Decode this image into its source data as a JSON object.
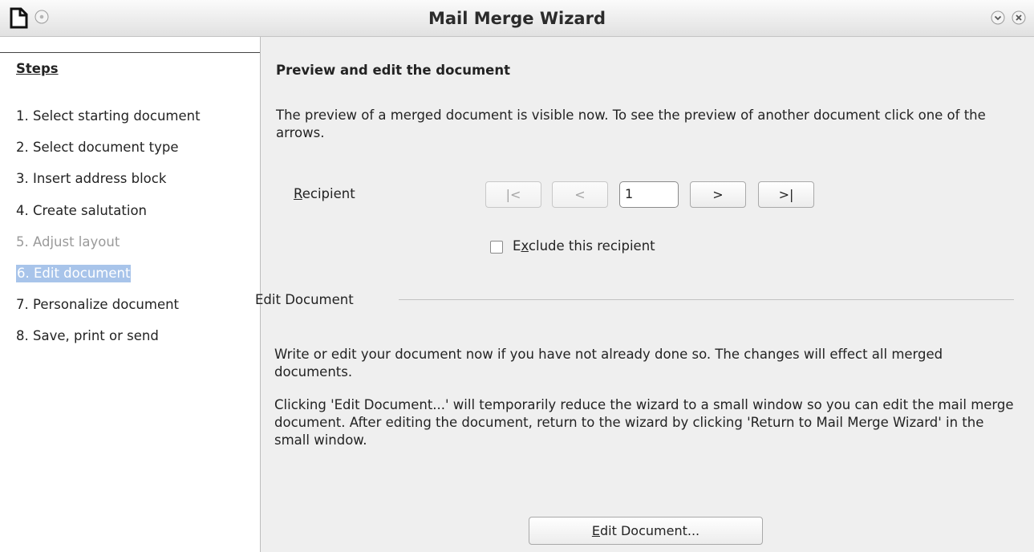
{
  "window": {
    "title": "Mail Merge Wizard"
  },
  "steps": {
    "heading": "Steps",
    "items": [
      {
        "label": "1. Select starting document",
        "state": "normal"
      },
      {
        "label": "2. Select document type",
        "state": "normal"
      },
      {
        "label": "3. Insert address block",
        "state": "normal"
      },
      {
        "label": "4. Create salutation",
        "state": "normal"
      },
      {
        "label": "5. Adjust layout",
        "state": "disabled"
      },
      {
        "label": "6. Edit document",
        "state": "selected"
      },
      {
        "label": "7. Personalize document",
        "state": "normal"
      },
      {
        "label": "8. Save, print or send",
        "state": "normal"
      }
    ]
  },
  "preview": {
    "heading": "Preview and edit the document",
    "intro": "The preview of a merged document is visible now. To see the preview of another document click one of the arrows.",
    "recipient_label_mnemonic": "R",
    "recipient_label_rest": "ecipient",
    "first_btn": "|<",
    "prev_btn": "<",
    "recipient_value": "1",
    "next_btn": ">",
    "last_btn": ">|",
    "exclude_mnemonic_pre": "E",
    "exclude_mnemonic": "x",
    "exclude_rest": "clude this recipient",
    "exclude_checked": false
  },
  "edit": {
    "section_label": "Edit Document",
    "para1": "Write or edit your document now if you have not already done so. The changes will effect all merged documents.",
    "para2": "Clicking 'Edit Document...' will temporarily reduce the wizard to a small window so you can edit the mail merge document. After editing the document, return to the wizard by clicking 'Return to Mail Merge Wizard' in the small window.",
    "button_mnemonic": "E",
    "button_rest": "dit Document..."
  },
  "icons": {
    "app": "document-icon",
    "menu": "window-menu-icon",
    "minimize": "minimize-icon",
    "close": "close-icon"
  },
  "colors": {
    "selection": "#a8c4ea",
    "disabled_text": "#9a9a9a"
  }
}
